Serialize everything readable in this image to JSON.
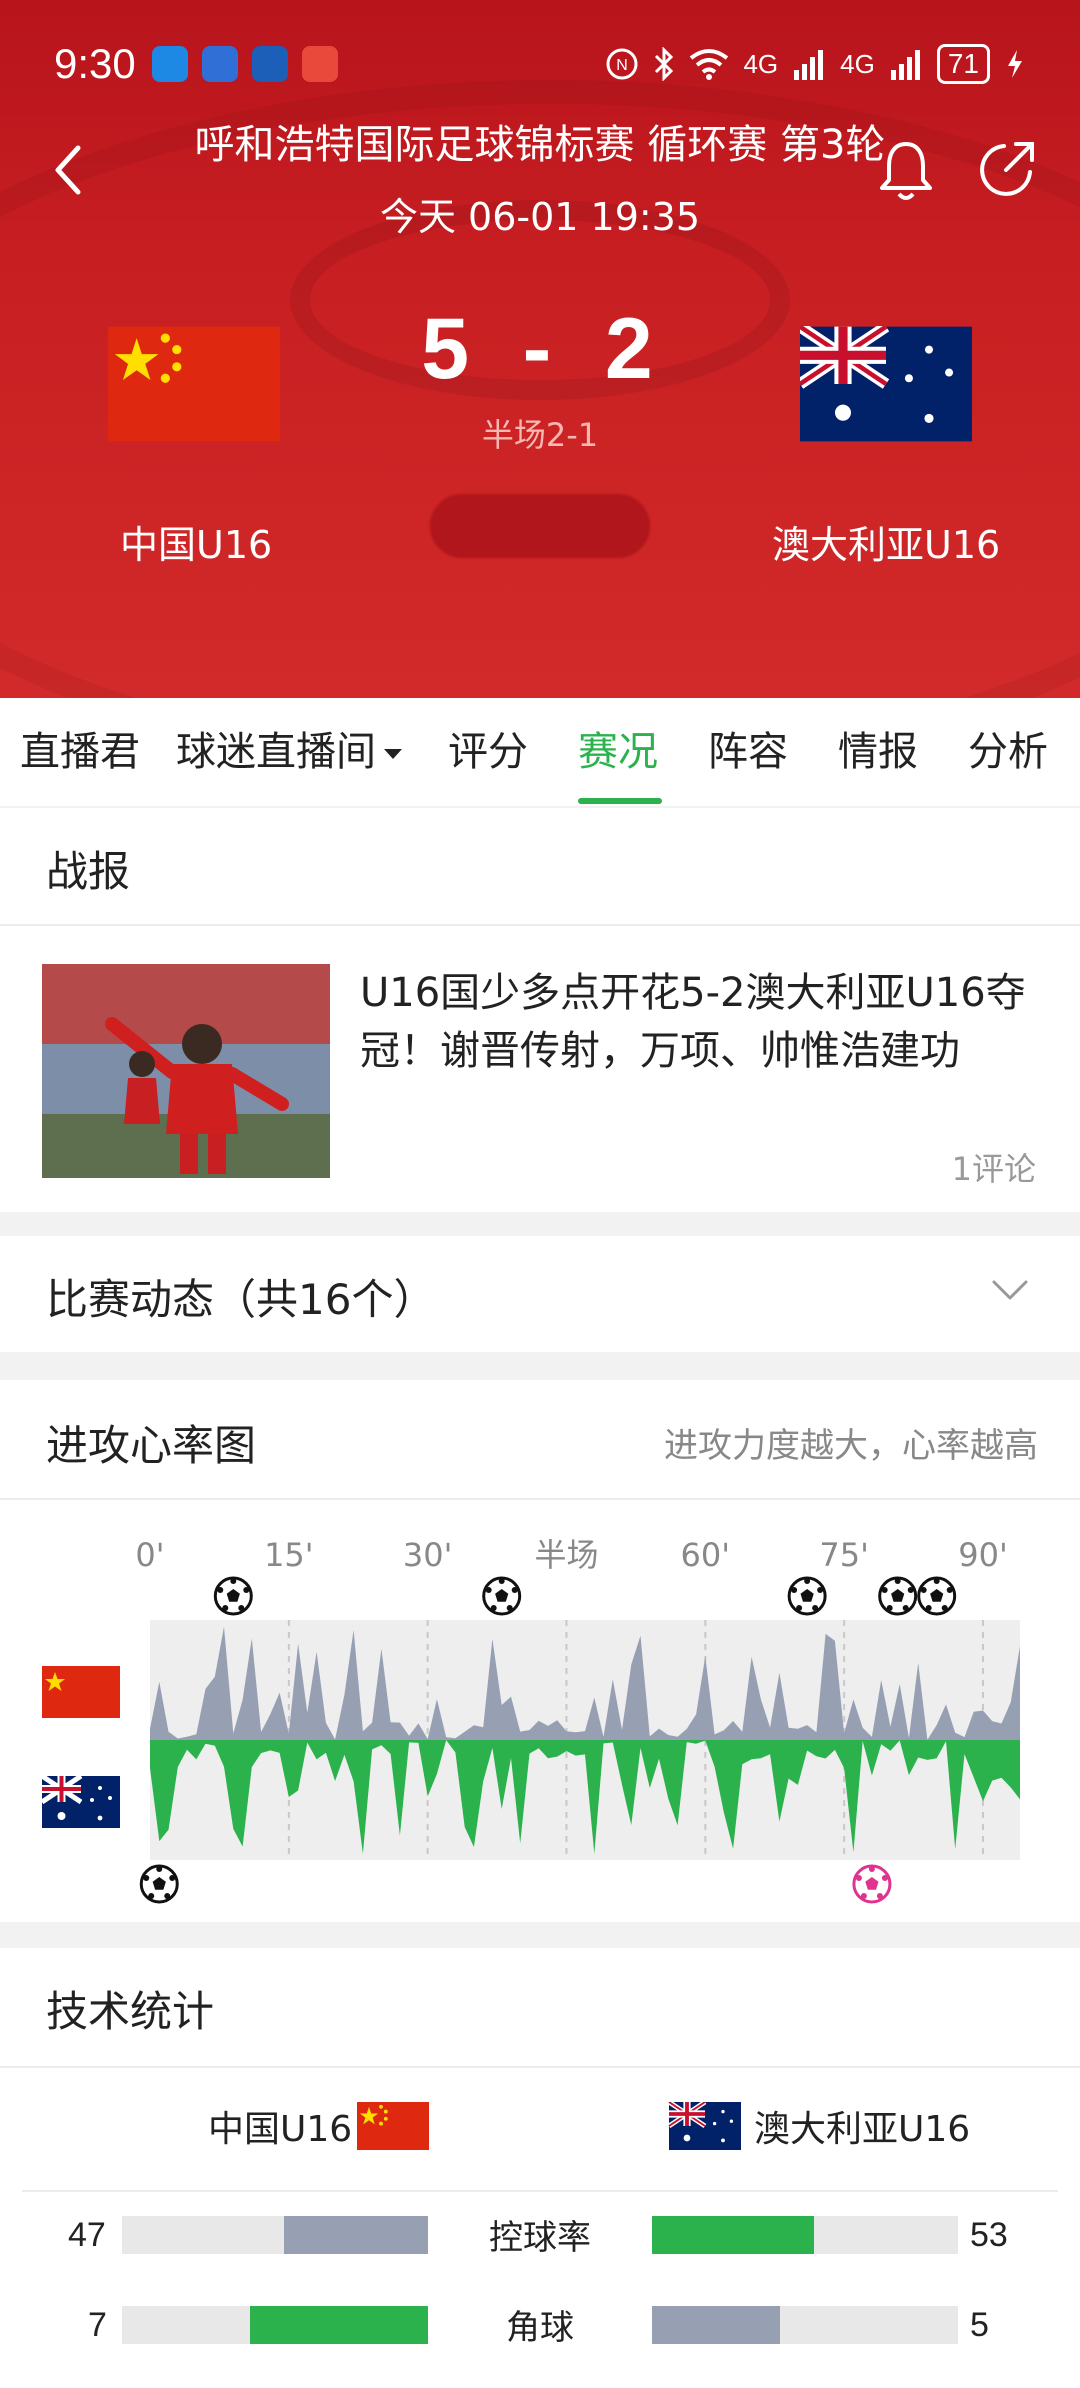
{
  "status_bar": {
    "time": "9:30",
    "battery": "71",
    "network_1": "4G",
    "network_2": "4G",
    "icons": [
      "message-icon",
      "app-icon",
      "app-icon",
      "toutiao-icon",
      "nfc-icon",
      "bluetooth-icon",
      "wifi-icon",
      "signal-icon",
      "battery-icon"
    ]
  },
  "header": {
    "title": "呼和浩特国际足球锦标赛 循环赛 第3轮",
    "datetime": "今天 06-01 19:35",
    "home_team": "中国U16",
    "away_team": "澳大利亚U16",
    "home_score": "5",
    "away_score": "2",
    "separator": "-",
    "halftime": "半场2-1"
  },
  "tabs": [
    "直播君",
    "球迷直播间",
    "评分",
    "赛况",
    "阵容",
    "情报",
    "分析"
  ],
  "active_tab": "赛况",
  "report": {
    "section_title": "战报",
    "news_title": "U16国少多点开花5-2澳大利亚U16夺冠！谢晋传射，万项、帅惟浩建功",
    "comments": "1评论"
  },
  "events": {
    "title": "比赛动态（共16个）"
  },
  "momentum": {
    "title": "进攻心率图",
    "note": "进攻力度越大，心率越高",
    "axis_labels": [
      "0'",
      "15'",
      "30'",
      "半场",
      "60'",
      "75'",
      "90'"
    ],
    "home_goal_minutes": [
      9,
      38,
      71,
      81,
      85
    ],
    "away_goal_minutes": [
      1,
      78
    ],
    "away_own_goal_minute": 78
  },
  "stats": {
    "title": "技术统计",
    "home_team": "中国U16",
    "away_team": "澳大利亚U16",
    "rows": [
      {
        "label": "控球率",
        "home": "47",
        "away": "53",
        "home_value": 47,
        "away_value": 53,
        "leader": "away"
      },
      {
        "label": "角球",
        "home": "7",
        "away": "5",
        "home_value": 7,
        "away_value": 5,
        "leader": "home"
      }
    ]
  },
  "colors": {
    "header_red": "#c81f22",
    "accent_green": "#2bb24c",
    "muted_gray": "#97a0b3"
  }
}
